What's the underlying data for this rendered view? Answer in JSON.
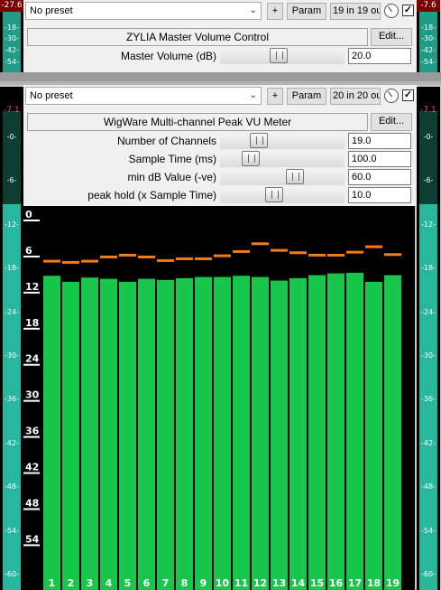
{
  "left_meter": {
    "peak": "-27.6",
    "ticks_top": [
      "-18-",
      "-30-",
      "-42-",
      "-54-"
    ],
    "peak2": "-7.1",
    "ticks": [
      "-0-",
      "-6-",
      "-12-",
      "-18-",
      "-24-",
      "-30-",
      "-36-",
      "-42-",
      "-48-",
      "-54-",
      "-60-"
    ]
  },
  "right_meter": {
    "peak": "-7.6",
    "ticks_top": [
      "-18-",
      "-30-",
      "-42-",
      "-54-"
    ],
    "peak2": "-7.1",
    "ticks": [
      "-0-",
      "-6-",
      "-12-",
      "-18-",
      "-24-",
      "-30-",
      "-36-",
      "-42-",
      "-48-",
      "-54-",
      "-60-"
    ]
  },
  "plugin1": {
    "preset": "No preset",
    "plus": "+",
    "param": "Param",
    "io": "19 in 19 ou",
    "bypass_checked": "✓",
    "title": "ZYLIA Master Volume Control",
    "edit": "Edit...",
    "params": [
      {
        "label": "Master Volume (dB)",
        "value": "20.0",
        "level": 0.47
      }
    ]
  },
  "plugin2": {
    "preset": "No preset",
    "plus": "+",
    "param": "Param",
    "io": "20 in 20 ou",
    "bypass_checked": "✓",
    "title": "WigWare Multi-channel Peak VU Meter",
    "edit": "Edit...",
    "params": [
      {
        "label": "Number of Channels",
        "value": "19.0",
        "level": 0.28
      },
      {
        "label": "Sample Time (ms)",
        "value": "100.0",
        "level": 0.2
      },
      {
        "label": "min dB Value (-ve)",
        "value": "60.0",
        "level": 0.62
      },
      {
        "label": "peak hold (x Sample Time)",
        "value": "10.0",
        "level": 0.42
      }
    ]
  },
  "colors": {
    "bar": "#17c64a",
    "peak": "#f07d1a",
    "background": "#000000",
    "meter_fill": "#27b79c"
  },
  "chart_data": {
    "type": "bar",
    "categories": [
      "1",
      "2",
      "3",
      "4",
      "5",
      "6",
      "7",
      "8",
      "9",
      "10",
      "11",
      "12",
      "13",
      "14",
      "15",
      "16",
      "17",
      "18",
      "19"
    ],
    "series": [
      {
        "values": [
          -11.0,
          -12.0,
          -11.3,
          -11.5,
          -12.0,
          -11.5,
          -11.7,
          -11.4,
          -11.2,
          -11.2,
          -11.0,
          -11.2,
          -11.8,
          -11.4,
          -10.9,
          -10.6,
          -10.5,
          -12.0,
          -10.9
        ]
      },
      {
        "values": [
          -8.5,
          -8.7,
          -8.5,
          -7.8,
          -7.5,
          -7.8,
          -8.4,
          -8.1,
          -8.1,
          -7.6,
          -6.9,
          -5.6,
          -6.7,
          -7.1,
          -7.5,
          -7.5,
          -7.0,
          -6.1,
          -7.4
        ]
      }
    ],
    "y_ticks": [
      "0",
      "6",
      "12",
      "18",
      "24",
      "30",
      "36",
      "42",
      "48",
      "54"
    ],
    "ylim": [
      -60,
      0
    ]
  }
}
